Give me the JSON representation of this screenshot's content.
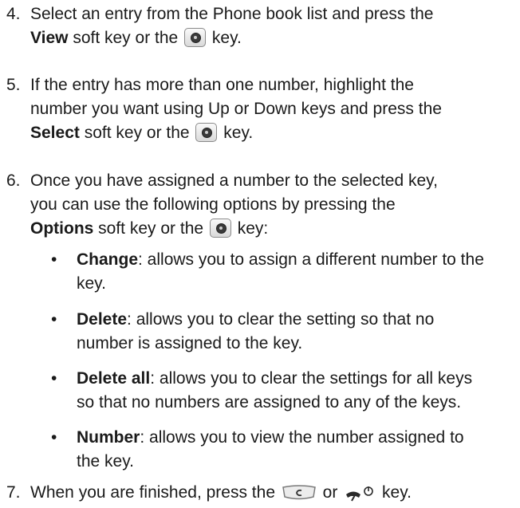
{
  "steps": [
    {
      "num": "4.",
      "l1": "Select an entry from the Phone book list and press the",
      "b": "View",
      "t1": " soft key or the ",
      "t2": " key."
    },
    {
      "num": "5.",
      "l1": "If the entry has more than one number, highlight the",
      "l2": "number you want using Up or Down keys and press the",
      "b": "Select",
      "t1": " soft key or the ",
      "t2": " key."
    },
    {
      "num": "6.",
      "l1": "Once you have assigned a number to the selected key,",
      "l2": "you can use the following options by pressing the",
      "b": "Options",
      "t1": " soft key or the ",
      "t2": " key:"
    },
    {
      "num": "7.",
      "t1": "When you are finished, press the ",
      "t2": " or ",
      "t3": " key."
    }
  ],
  "bullets": [
    {
      "dot": "•",
      "b": "Change",
      "t1": ": allows you to assign a different number to the",
      "t2": "key."
    },
    {
      "dot": "•",
      "b": "Delete",
      "t1": ": allows you to clear the setting so that no",
      "t2": "number is assigned to the key."
    },
    {
      "dot": "•",
      "b": "Delete all",
      "t1": ": allows you to clear the settings for all keys",
      "t2": "so that no numbers are assigned to any of the keys."
    },
    {
      "dot": "•",
      "b": "Number",
      "t1": ": allows you to view the number assigned to",
      "t2": "the key."
    }
  ]
}
